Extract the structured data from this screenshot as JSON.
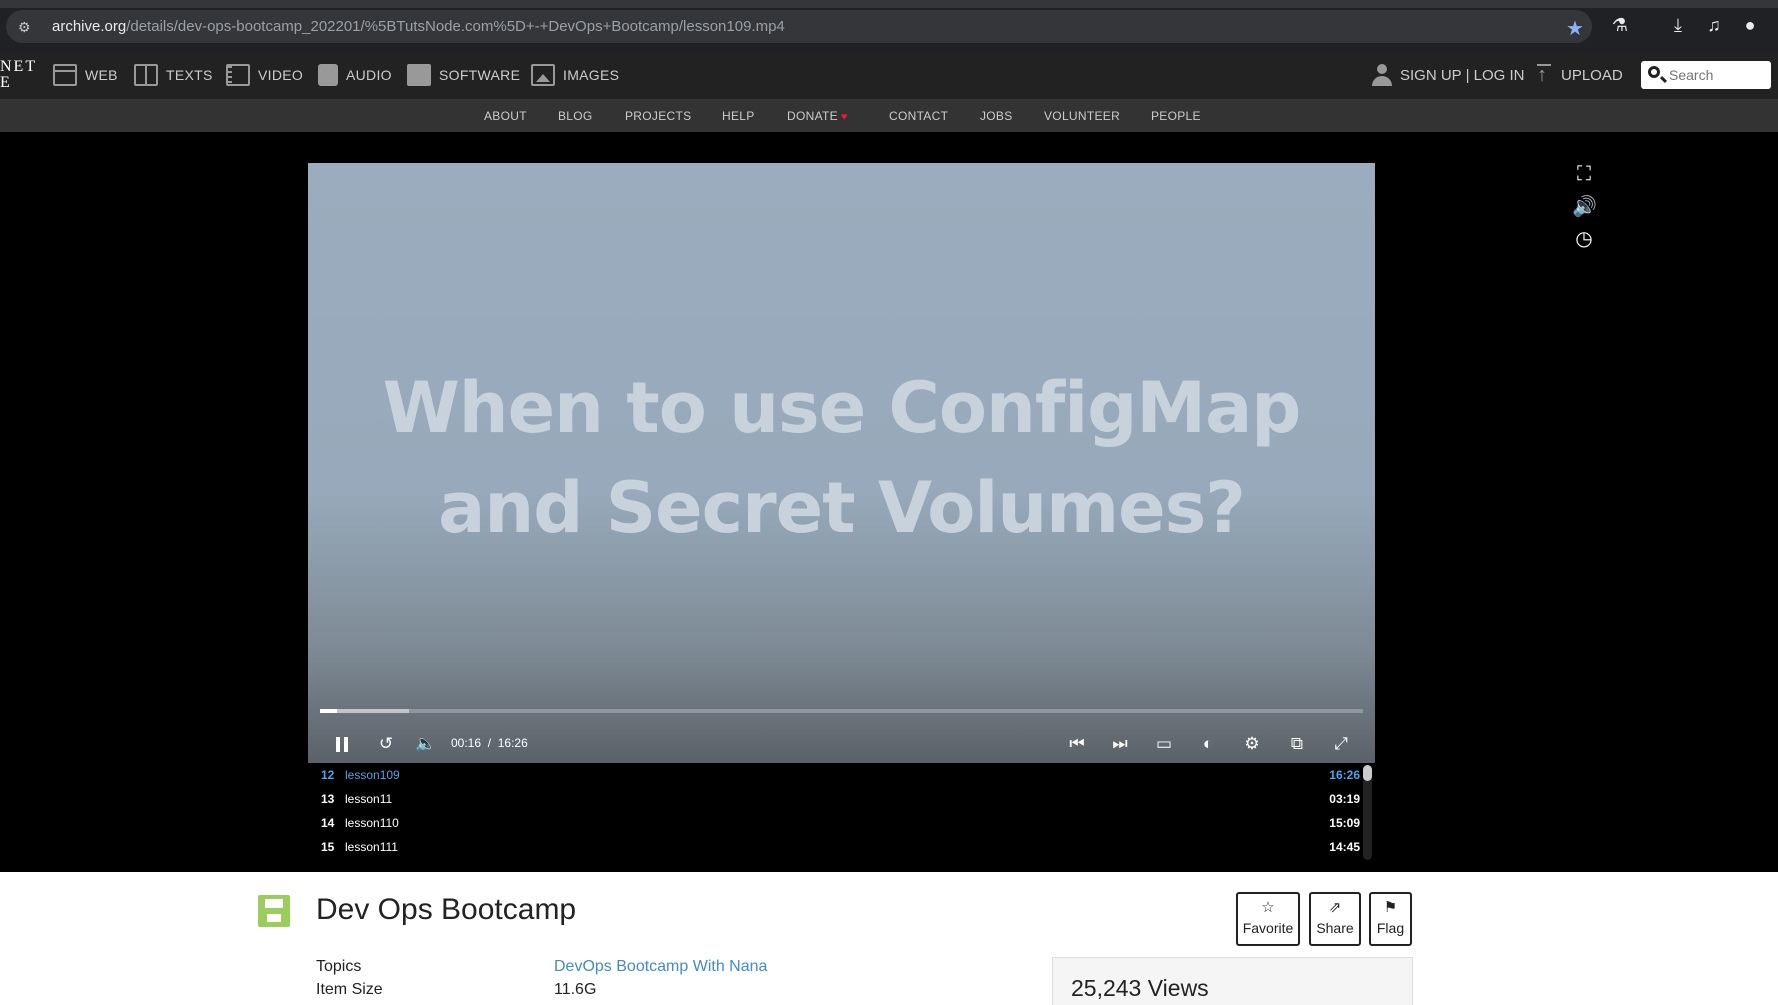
{
  "browser": {
    "url_host": "archive.org",
    "url_path": "/details/dev-ops-bootcamp_202201/%5BTutsNode.com%5D+-+DevOps+Bootcamp/lesson109.mp4"
  },
  "ia_nav": {
    "logo_line1": "NET",
    "logo_line2": "E",
    "items": [
      {
        "label": "WEB",
        "icon": "web-icon"
      },
      {
        "label": "TEXTS",
        "icon": "texts-icon"
      },
      {
        "label": "VIDEO",
        "icon": "video-icon"
      },
      {
        "label": "AUDIO",
        "icon": "audio-icon"
      },
      {
        "label": "SOFTWARE",
        "icon": "software-icon"
      },
      {
        "label": "IMAGES",
        "icon": "images-icon"
      }
    ],
    "signup_label": "SIGN UP | LOG IN",
    "upload_label": "UPLOAD",
    "search_placeholder": "Search"
  },
  "sub_nav": {
    "items": [
      "ABOUT",
      "BLOG",
      "PROJECTS",
      "HELP",
      "DONATE",
      "CONTACT",
      "JOBS",
      "VOLUNTEER",
      "PEOPLE"
    ]
  },
  "player": {
    "video_title_line1": "When to use ConfigMap",
    "video_title_line2": "and Secret Volumes?",
    "current_time": "00:16",
    "time_separator": "/",
    "duration": "16:26",
    "progress_fraction": 0.016,
    "buffered_fraction": 0.085
  },
  "playlist": [
    {
      "num": "12",
      "name": "lesson109",
      "duration": "16:26",
      "active": true
    },
    {
      "num": "13",
      "name": "lesson11",
      "duration": "03:19",
      "active": false
    },
    {
      "num": "14",
      "name": "lesson110",
      "duration": "15:09",
      "active": false
    },
    {
      "num": "15",
      "name": "lesson111",
      "duration": "14:45",
      "active": false
    }
  ],
  "item": {
    "title": "Dev Ops Bootcamp",
    "actions": [
      {
        "label": "Favorite",
        "glyph": "☆"
      },
      {
        "label": "Share",
        "glyph": "⇗"
      },
      {
        "label": "Flag",
        "glyph": "⚑"
      }
    ],
    "meta": [
      {
        "key": "Topics",
        "value": "DevOps Bootcamp With Nana"
      },
      {
        "key": "Item Size",
        "value": "11.6G"
      }
    ],
    "views": "25,243 Views"
  },
  "colors": {
    "accent_blue": "#4aa6ea",
    "link_blue": "#428bca",
    "heart_red": "#e0202c",
    "software_icon_green": "#9bcd5c"
  }
}
